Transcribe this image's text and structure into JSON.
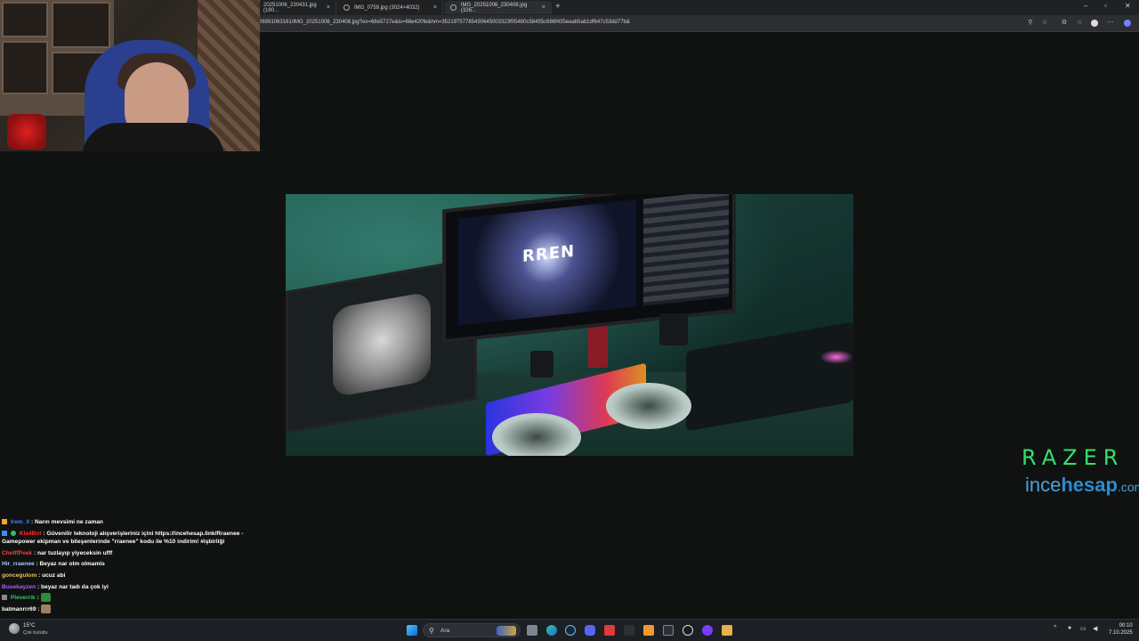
{
  "browser": {
    "tabs": [
      {
        "title": "20251006_230431.jpg (180..."
      },
      {
        "title": "IMG_0759.jpg (3024×4032)"
      },
      {
        "title": "IMG_20251006_230408.jpg (326..."
      }
    ],
    "url": "26991063161/IMG_20251006_230408.jpg?ex=68e5727e&is=68e420fe&hm=35219757785430645003323f05480c58455c686f435eaab5ab1df647c53dd77b&",
    "new_tab_symbol": "+",
    "window_controls": [
      "–",
      "▫",
      "✕"
    ]
  },
  "photo": {
    "monitor_text": "RREN"
  },
  "sponsor": {
    "razer": "RAZER",
    "brand_part1": "ince",
    "brand_part2": "hesap",
    "brand_part3": ".com"
  },
  "chat": {
    "messages": [
      {
        "user": "Irem_0",
        "user_color": "#4b7bff",
        "text": ": Narın mevsimi ne zaman"
      },
      {
        "user": "Kla4Bot",
        "user_color": "#ff2b2b",
        "text": ": Güvenilir teknoloji alışverişleriniz içini https://incehesap.link/Rraenee - Gamepower ekipman ve bileşenlerinde \"rraenee\" kodu ile %10 indirim! #işbirliği"
      },
      {
        "user": "ChelffPeek",
        "user_color": "#ff3b3b",
        "text": ": nar tuzlayıp yiyeceksin ufff"
      },
      {
        "user": "Hir_rraenee",
        "user_color": "#9ad0ff",
        "text": ": Beyaz nar olm olmamis"
      },
      {
        "user": "goncegulom",
        "user_color": "#e6c35a",
        "text": ": ucuz abi"
      },
      {
        "user": "Busekayzen",
        "user_color": "#b05cff",
        "text": ": beyaz nar tadı da çok iyi"
      },
      {
        "user": "Pleverrik",
        "user_color": "#34c36a",
        "text": ":"
      },
      {
        "user": "batmanrrr69",
        "user_color": "#ffffff",
        "text": ":"
      }
    ]
  },
  "taskbar": {
    "weather_temp": "15°C",
    "weather_desc": "Çok bulutlu",
    "search_label": "Ara",
    "time": "00:10",
    "date": "7.10.2025"
  }
}
